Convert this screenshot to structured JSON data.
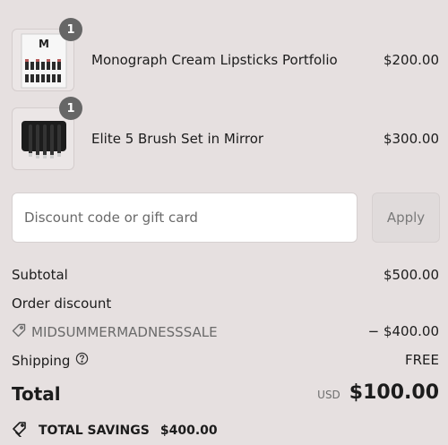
{
  "cart": {
    "items": [
      {
        "name": "Monograph Cream Lipsticks Portfolio",
        "price": "$200.00",
        "quantity": "1",
        "thumbnail_logo": "M"
      },
      {
        "name": "Elite 5 Brush Set in Mirror",
        "price": "$300.00",
        "quantity": "1"
      }
    ]
  },
  "discount": {
    "placeholder": "Discount code or gift card",
    "apply_label": "Apply"
  },
  "summary": {
    "subtotal_label": "Subtotal",
    "subtotal_value": "$500.00",
    "order_discount_label": "Order discount",
    "discount_code": "MIDSUMMERMADNESSSALE",
    "discount_value": "− $400.00",
    "shipping_label": "Shipping",
    "shipping_value": "FREE",
    "total_label": "Total",
    "currency": "USD",
    "total_value": "$100.00",
    "savings_label": "TOTAL SAVINGS",
    "savings_value": "$400.00"
  },
  "icons": {
    "discount_tag": "tag-icon",
    "shipping_info": "help-circle-icon",
    "savings": "savings-tag-icon"
  }
}
